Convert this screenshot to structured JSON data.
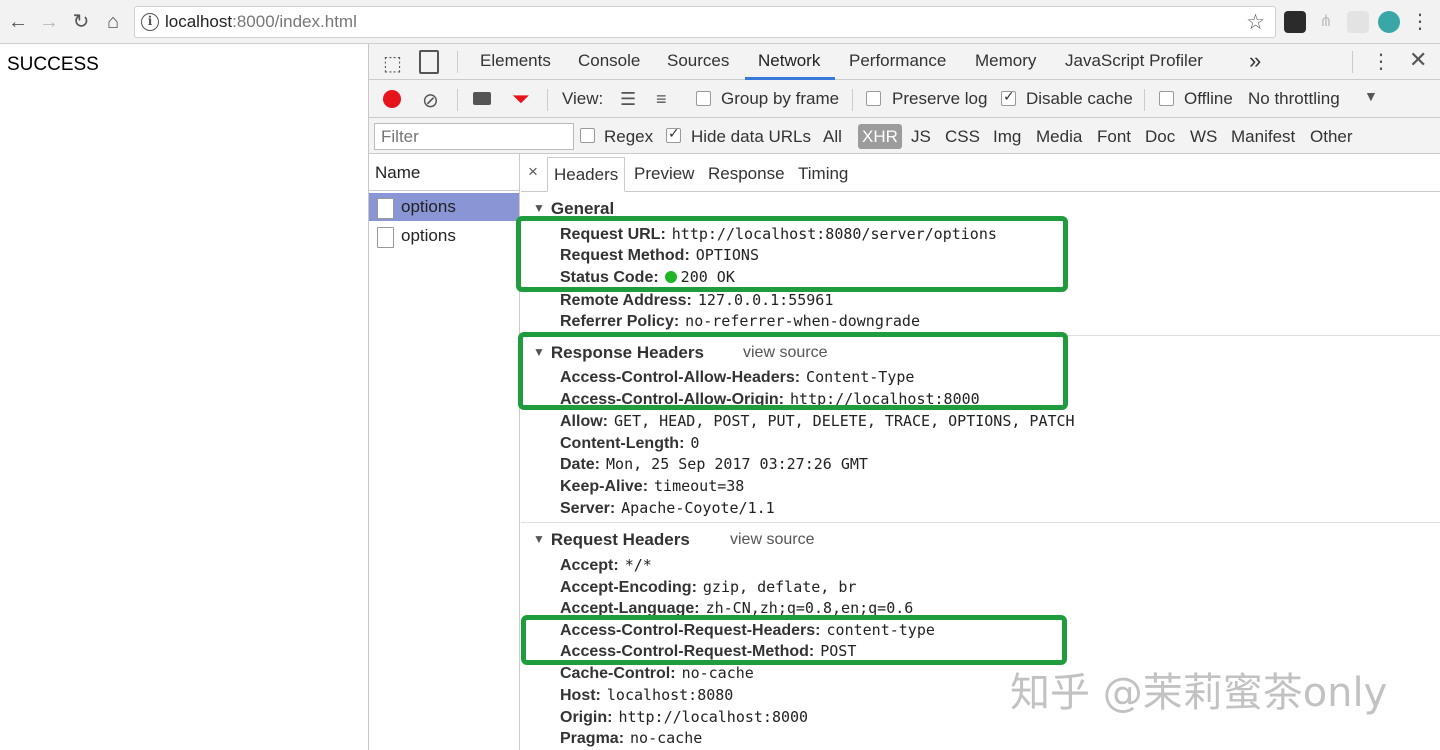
{
  "browser": {
    "url_host": "localhost",
    "url_rest": ":8000/index.html"
  },
  "page": {
    "text": "SUCCESS"
  },
  "devtools": {
    "tabs": [
      "Elements",
      "Console",
      "Sources",
      "Network",
      "Performance",
      "Memory",
      "JavaScript Profiler"
    ],
    "active_tab": "Network",
    "more_tabs": "»",
    "toolbar": {
      "view_label": "View:",
      "group_by_frame": "Group by frame",
      "preserve_log": "Preserve log",
      "disable_cache": "Disable cache",
      "offline": "Offline",
      "throttling": "No throttling",
      "disable_cache_checked": true
    },
    "filter_bar": {
      "placeholder": "Filter",
      "regex": "Regex",
      "hide_data_urls": "Hide data URLs",
      "types": [
        "All",
        "XHR",
        "JS",
        "CSS",
        "Img",
        "Media",
        "Font",
        "Doc",
        "WS",
        "Manifest",
        "Other"
      ],
      "active_type": "XHR"
    },
    "request_list": {
      "header": "Name",
      "items": [
        "options",
        "options"
      ]
    },
    "detail": {
      "close": "×",
      "tabs": [
        "Headers",
        "Preview",
        "Response",
        "Timing"
      ],
      "active_tab": "Headers",
      "view_source": "view source",
      "general": {
        "title": "General",
        "rows": [
          {
            "k": "Request URL:",
            "v": "http://localhost:8080/server/options"
          },
          {
            "k": "Request Method:",
            "v": "OPTIONS"
          },
          {
            "k": "Status Code:",
            "v": "200 OK"
          },
          {
            "k": "Remote Address:",
            "v": "127.0.0.1:55961"
          },
          {
            "k": "Referrer Policy:",
            "v": "no-referrer-when-downgrade"
          }
        ]
      },
      "response_headers": {
        "title": "Response Headers",
        "rows": [
          {
            "k": "Access-Control-Allow-Headers:",
            "v": "Content-Type"
          },
          {
            "k": "Access-Control-Allow-Origin:",
            "v": "http://localhost:8000"
          },
          {
            "k": "Allow:",
            "v": "GET, HEAD, POST, PUT, DELETE, TRACE, OPTIONS, PATCH"
          },
          {
            "k": "Content-Length:",
            "v": "0"
          },
          {
            "k": "Date:",
            "v": "Mon, 25 Sep 2017 03:27:26 GMT"
          },
          {
            "k": "Keep-Alive:",
            "v": "timeout=38"
          },
          {
            "k": "Server:",
            "v": "Apache-Coyote/1.1"
          }
        ]
      },
      "request_headers": {
        "title": "Request Headers",
        "rows": [
          {
            "k": "Accept:",
            "v": "*/*"
          },
          {
            "k": "Accept-Encoding:",
            "v": "gzip, deflate, br"
          },
          {
            "k": "Accept-Language:",
            "v": "zh-CN,zh;q=0.8,en;q=0.6"
          },
          {
            "k": "Access-Control-Request-Headers:",
            "v": "content-type"
          },
          {
            "k": "Access-Control-Request-Method:",
            "v": "POST"
          },
          {
            "k": "Cache-Control:",
            "v": "no-cache"
          },
          {
            "k": "Host:",
            "v": "localhost:8080"
          },
          {
            "k": "Origin:",
            "v": "http://localhost:8000"
          },
          {
            "k": "Pragma:",
            "v": "no-cache"
          }
        ]
      }
    }
  },
  "watermark": "知乎 @茉莉蜜茶only",
  "colors": {
    "highlight_box": "#1f9d3e",
    "selected_row": "#8a95d6",
    "status_dot": "#21b526",
    "record": "#e8141b",
    "filter_icon": "#e8141b",
    "active_tab_underline": "#3879d9"
  }
}
